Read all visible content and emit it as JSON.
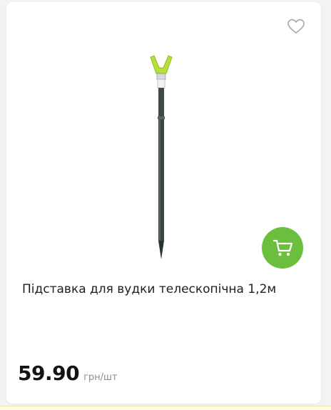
{
  "product": {
    "title": "Підставка для вудки телескопічна 1,2м",
    "price": "59.90",
    "unit": "грн/шт"
  },
  "icons": {
    "wishlist": "heart-icon",
    "cart": "cart-icon"
  },
  "colors": {
    "accent_green": "#6cbf3c",
    "rest_tip": "#b6e03a",
    "rod": "#3c4746"
  }
}
